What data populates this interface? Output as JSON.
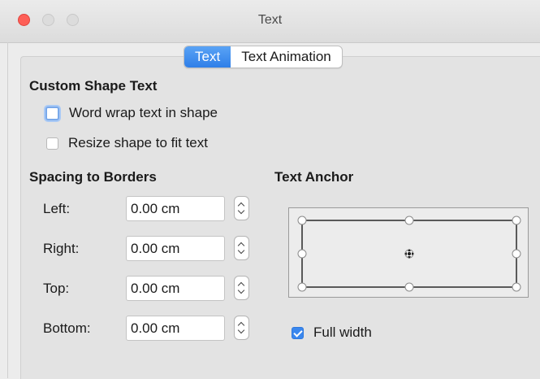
{
  "window": {
    "title": "Text"
  },
  "tabs": [
    {
      "label": "Text",
      "active": true
    },
    {
      "label": "Text Animation",
      "active": false
    }
  ],
  "custom_shape_text": {
    "heading": "Custom Shape Text",
    "word_wrap": {
      "label": "Word wrap text in shape",
      "checked": false,
      "focused": true
    },
    "resize_shape": {
      "label": "Resize shape to fit text",
      "checked": false
    }
  },
  "spacing": {
    "heading": "Spacing to Borders",
    "left": {
      "label": "Left:",
      "value": "0.00 cm"
    },
    "right": {
      "label": "Right:",
      "value": "0.00 cm"
    },
    "top": {
      "label": "Top:",
      "value": "0.00 cm"
    },
    "bottom": {
      "label": "Bottom:",
      "value": "0.00 cm"
    }
  },
  "text_anchor": {
    "heading": "Text Anchor",
    "selected": "center",
    "full_width": {
      "label": "Full width",
      "checked": true
    }
  },
  "colors": {
    "accent": "#3a87ee",
    "close": "#fe5f57"
  }
}
